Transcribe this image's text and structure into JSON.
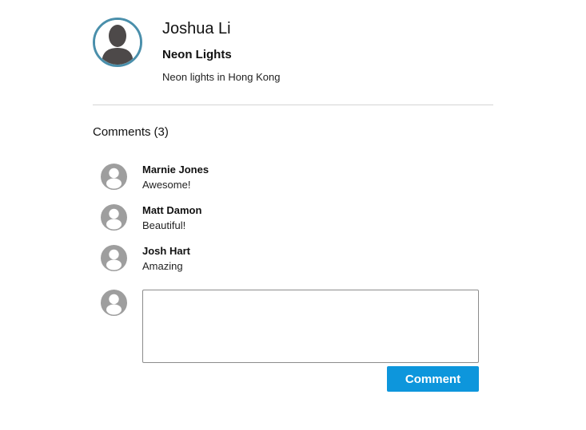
{
  "post": {
    "author_name": "Joshua Li",
    "title": "Neon Lights",
    "description": "Neon lights in Hong Kong"
  },
  "comments_section": {
    "heading": "Comments",
    "count": "(3)",
    "items": [
      {
        "author": "Marnie Jones",
        "text": "Awesome!"
      },
      {
        "author": "Matt Damon",
        "text": "Beautiful!"
      },
      {
        "author": "Josh Hart",
        "text": "Amazing"
      }
    ]
  },
  "composer": {
    "value": "",
    "button_label": "Comment"
  },
  "colors": {
    "accent": "#0d96dc",
    "avatar_ring": "#4a8fab",
    "placeholder_avatar": "#9e9e9e",
    "author_silhouette": "#4d4949"
  }
}
